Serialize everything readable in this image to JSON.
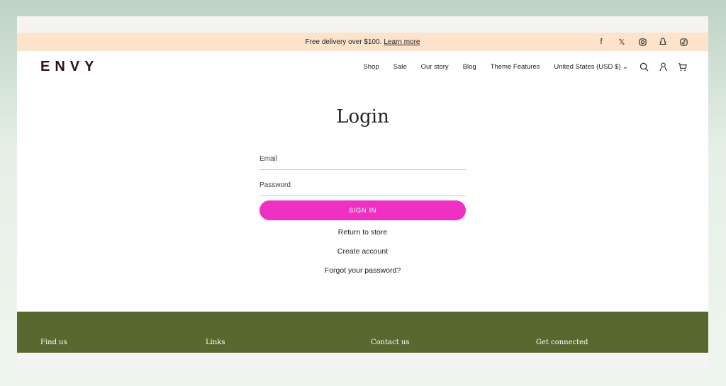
{
  "banner": {
    "text": "Free delivery over $100.",
    "link": "Learn more",
    "social": [
      "facebook-icon",
      "x-icon",
      "instagram-icon",
      "snapchat-icon",
      "tiktok-icon"
    ]
  },
  "header": {
    "logo": "ENVY",
    "nav": [
      "Shop",
      "Sale",
      "Our story",
      "Blog",
      "Theme Features"
    ],
    "currency": "United States (USD $)"
  },
  "login": {
    "title": "Login",
    "email_placeholder": "Email",
    "password_placeholder": "Password",
    "sign_in": "SIGN IN",
    "links": [
      "Return to store",
      "Create account",
      "Forgot your password?"
    ]
  },
  "footer": {
    "columns": [
      "Find us",
      "Links",
      "Contact us",
      "Get connected"
    ]
  },
  "colors": {
    "banner": "#fde3cb",
    "button": "#ee31c3",
    "footer": "#57692f",
    "logo": "#2a1218"
  }
}
